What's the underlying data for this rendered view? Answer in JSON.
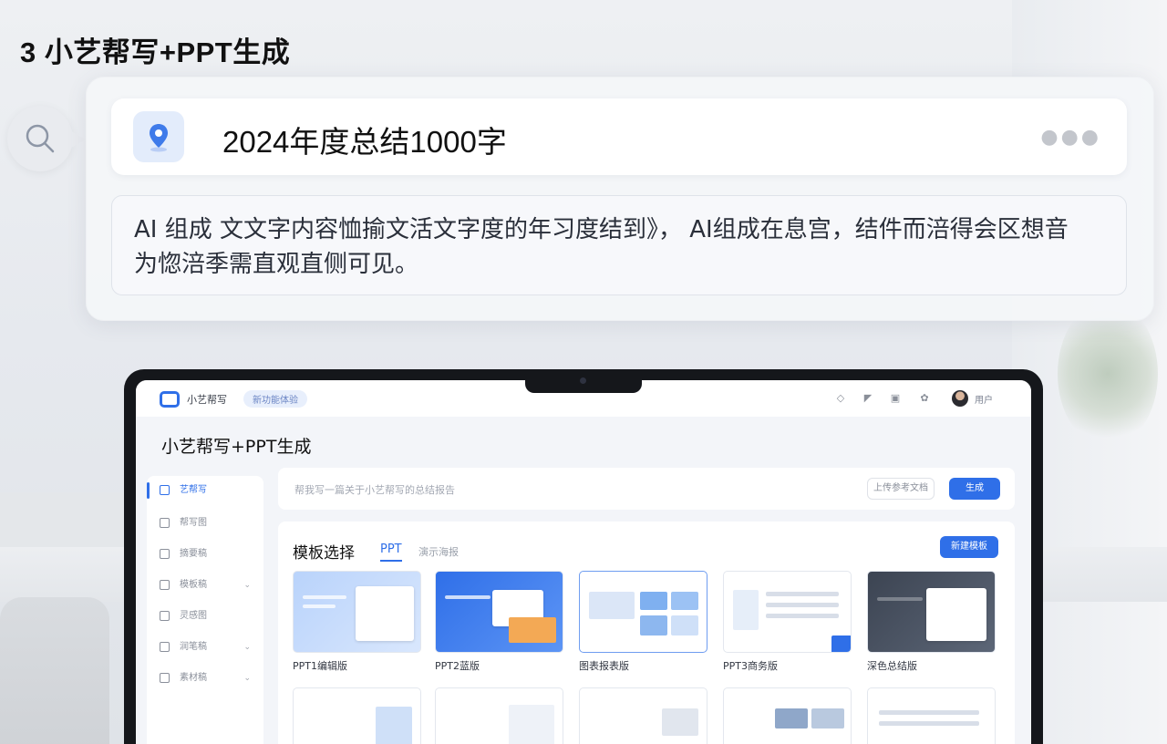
{
  "heading": "3  小艺帮写+PPT生成",
  "query": {
    "text": "2024年度总结1000字",
    "more_icon": "more-horizontal-icon"
  },
  "answer": {
    "line1": "AI  组成  文文字内容恤揄文活文字度的年习度结到》，  AI组成在息宫，结件而涪得会区想音",
    "line2": "为惚涪季需直观直侧可见。"
  },
  "app": {
    "name": "小艺帮写",
    "tag": "新功能体验",
    "page_title": "小艺帮写+PPT生成",
    "user": "用户"
  },
  "sidebar": {
    "items": [
      {
        "label": "艺帮写",
        "active": true,
        "chevron": false
      },
      {
        "label": "帮写图",
        "active": false,
        "chevron": false
      },
      {
        "label": "摘要稿",
        "active": false,
        "chevron": false
      },
      {
        "label": "模板稿",
        "active": false,
        "chevron": true
      },
      {
        "label": "灵感图",
        "active": false,
        "chevron": false
      },
      {
        "label": "润笔稿",
        "active": false,
        "chevron": true
      },
      {
        "label": "素材稿",
        "active": false,
        "chevron": true
      }
    ]
  },
  "search_row": {
    "placeholder": "帮我写一篇关于小艺帮写的总结报告",
    "ghost_button": "上传参考文档",
    "primary_button": "生成"
  },
  "templates": {
    "title": "模板选择",
    "tabs": [
      "PPT",
      "演示海报"
    ],
    "new_button": "新建模板",
    "cards": [
      {
        "label": "PPT1编辑版",
        "style": "c1"
      },
      {
        "label": "PPT2蓝版",
        "style": "c2"
      },
      {
        "label": "图表报表版",
        "style": "c3"
      },
      {
        "label": "PPT3商务版",
        "style": "c4"
      },
      {
        "label": "深色总结版",
        "style": "c5"
      }
    ]
  },
  "colors": {
    "accent": "#2f6fe8",
    "heading": "#111111"
  }
}
